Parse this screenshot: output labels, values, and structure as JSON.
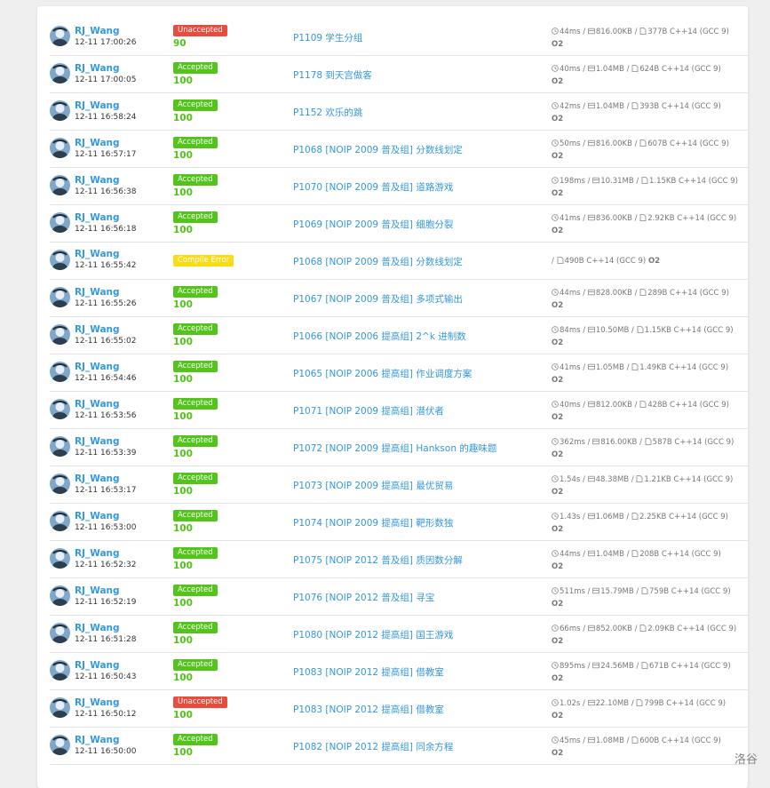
{
  "records": [
    {
      "user": "RJ_Wang",
      "time": "12-11 17:00:26",
      "status": "Unaccepted",
      "status_kind": "wa",
      "score": "90",
      "problem": "P1109 学生分组",
      "time_used": "44ms",
      "memory": "816.00KB",
      "code_size": "377B",
      "lang": "C++14 (GCC 9)",
      "opt": "O2",
      "wrap": false
    },
    {
      "user": "RJ_Wang",
      "time": "12-11 17:00:05",
      "status": "Accepted",
      "status_kind": "ac",
      "score": "100",
      "problem": "P1178 到天宫做客",
      "time_used": "40ms",
      "memory": "1.04MB",
      "code_size": "624B",
      "lang": "C++14 (GCC 9)",
      "opt": "O2",
      "wrap": false
    },
    {
      "user": "RJ_Wang",
      "time": "12-11 16:58:24",
      "status": "Accepted",
      "status_kind": "ac",
      "score": "100",
      "problem": "P1152 欢乐的跳",
      "time_used": "42ms",
      "memory": "1.04MB",
      "code_size": "393B",
      "lang": "C++14 (GCC 9)",
      "opt": "O2",
      "wrap": false
    },
    {
      "user": "RJ_Wang",
      "time": "12-11 16:57:17",
      "status": "Accepted",
      "status_kind": "ac",
      "score": "100",
      "problem": "P1068 [NOIP 2009 普及组] 分数线划定",
      "time_used": "50ms",
      "memory": "816.00KB",
      "code_size": "607B",
      "lang": "C++14 (GCC 9)",
      "opt": "O2",
      "wrap": false
    },
    {
      "user": "RJ_Wang",
      "time": "12-11 16:56:38",
      "status": "Accepted",
      "status_kind": "ac",
      "score": "100",
      "problem": "P1070 [NOIP 2009 普及组] 道路游戏",
      "time_used": "198ms",
      "memory": "10.31MB",
      "code_size": "1.15KB",
      "lang": "C++14 (GCC 9)",
      "opt": "O2",
      "wrap": true
    },
    {
      "user": "RJ_Wang",
      "time": "12-11 16:56:18",
      "status": "Accepted",
      "status_kind": "ac",
      "score": "100",
      "problem": "P1069 [NOIP 2009 普及组] 细胞分裂",
      "time_used": "41ms",
      "memory": "836.00KB",
      "code_size": "2.92KB",
      "lang": "C++14 (GCC 9)",
      "opt": "O2",
      "wrap": true
    },
    {
      "user": "RJ_Wang",
      "time": "12-11 16:55:42",
      "status": "Compile Error",
      "status_kind": "ce",
      "score": "",
      "problem": "P1068 [NOIP 2009 普及组] 分数线划定",
      "time_used": "",
      "memory": "",
      "code_size": "490B",
      "lang": "C++14 (GCC 9)",
      "opt": "O2",
      "wrap": false,
      "compile_error": true
    },
    {
      "user": "RJ_Wang",
      "time": "12-11 16:55:26",
      "status": "Accepted",
      "status_kind": "ac",
      "score": "100",
      "problem": "P1067 [NOIP 2009 普及组] 多项式输出",
      "time_used": "44ms",
      "memory": "828.00KB",
      "code_size": "289B",
      "lang": "C++14 (GCC 9)",
      "opt": "O2",
      "wrap": false
    },
    {
      "user": "RJ_Wang",
      "time": "12-11 16:55:02",
      "status": "Accepted",
      "status_kind": "ac",
      "score": "100",
      "problem": "P1066 [NOIP 2006 提高组] 2^k 进制数",
      "time_used": "84ms",
      "memory": "10.50MB",
      "code_size": "1.15KB",
      "lang": "C++14 (GCC 9)",
      "opt": "O2",
      "wrap": false
    },
    {
      "user": "RJ_Wang",
      "time": "12-11 16:54:46",
      "status": "Accepted",
      "status_kind": "ac",
      "score": "100",
      "problem": "P1065 [NOIP 2006 提高组] 作业调度方案",
      "time_used": "41ms",
      "memory": "1.05MB",
      "code_size": "1.49KB",
      "lang": "C++14 (GCC 9)",
      "opt": "O2",
      "wrap": false
    },
    {
      "user": "RJ_Wang",
      "time": "12-11 16:53:56",
      "status": "Accepted",
      "status_kind": "ac",
      "score": "100",
      "problem": "P1071 [NOIP 2009 提高组] 潜伏者",
      "time_used": "40ms",
      "memory": "812.00KB",
      "code_size": "428B",
      "lang": "C++14 (GCC 9)",
      "opt": "O2",
      "wrap": false
    },
    {
      "user": "RJ_Wang",
      "time": "12-11 16:53:39",
      "status": "Accepted",
      "status_kind": "ac",
      "score": "100",
      "problem": "P1072 [NOIP 2009 提高组] Hankson 的趣味题",
      "time_used": "362ms",
      "memory": "816.00KB",
      "code_size": "587B",
      "lang": "C++14 (GCC 9)",
      "opt": "O2",
      "wrap": false
    },
    {
      "user": "RJ_Wang",
      "time": "12-11 16:53:17",
      "status": "Accepted",
      "status_kind": "ac",
      "score": "100",
      "problem": "P1073 [NOIP 2009 提高组] 最优贸易",
      "time_used": "1.54s",
      "memory": "48.38MB",
      "code_size": "1.21KB",
      "lang": "C++14 (GCC 9)",
      "opt": "O2",
      "wrap": false
    },
    {
      "user": "RJ_Wang",
      "time": "12-11 16:53:00",
      "status": "Accepted",
      "status_kind": "ac",
      "score": "100",
      "problem": "P1074 [NOIP 2009 提高组] 靶形数独",
      "time_used": "1.43s",
      "memory": "1.06MB",
      "code_size": "2.25KB",
      "lang": "C++14 (GCC 9)",
      "opt": "O2",
      "wrap": false
    },
    {
      "user": "RJ_Wang",
      "time": "12-11 16:52:32",
      "status": "Accepted",
      "status_kind": "ac",
      "score": "100",
      "problem": "P1075 [NOIP 2012 普及组] 质因数分解",
      "time_used": "44ms",
      "memory": "1.04MB",
      "code_size": "208B",
      "lang": "C++14 (GCC 9)",
      "opt": "O2",
      "wrap": false
    },
    {
      "user": "RJ_Wang",
      "time": "12-11 16:52:19",
      "status": "Accepted",
      "status_kind": "ac",
      "score": "100",
      "problem": "P1076 [NOIP 2012 普及组] 寻宝",
      "time_used": "511ms",
      "memory": "15.79MB",
      "code_size": "759B",
      "lang": "C++14 (GCC 9)",
      "opt": "O2",
      "wrap": false
    },
    {
      "user": "RJ_Wang",
      "time": "12-11 16:51:28",
      "status": "Accepted",
      "status_kind": "ac",
      "score": "100",
      "problem": "P1080 [NOIP 2012 提高组] 国王游戏",
      "time_used": "66ms",
      "memory": "852.00KB",
      "code_size": "2.09KB",
      "lang": "C++14 (GCC 9)",
      "opt": "O2",
      "wrap": true
    },
    {
      "user": "RJ_Wang",
      "time": "12-11 16:50:43",
      "status": "Accepted",
      "status_kind": "ac",
      "score": "100",
      "problem": "P1083 [NOIP 2012 提高组] 借教室",
      "time_used": "895ms",
      "memory": "24.56MB",
      "code_size": "671B",
      "lang": "C++14 (GCC 9)",
      "opt": "O2",
      "wrap": false
    },
    {
      "user": "RJ_Wang",
      "time": "12-11 16:50:12",
      "status": "Unaccepted",
      "status_kind": "wa",
      "score": "100",
      "problem": "P1083 [NOIP 2012 提高组] 借教室",
      "time_used": "1.02s",
      "memory": "22.10MB",
      "code_size": "799B",
      "lang": "C++14 (GCC 9)",
      "opt": "O2",
      "wrap": false
    },
    {
      "user": "RJ_Wang",
      "time": "12-11 16:50:00",
      "status": "Accepted",
      "status_kind": "ac",
      "score": "100",
      "problem": "P1082 [NOIP 2012 提高组] 同余方程",
      "time_used": "45ms",
      "memory": "1.08MB",
      "code_size": "600B",
      "lang": "C++14 (GCC 9)",
      "opt": "O2",
      "wrap": false
    }
  ],
  "watermark": "洛谷"
}
